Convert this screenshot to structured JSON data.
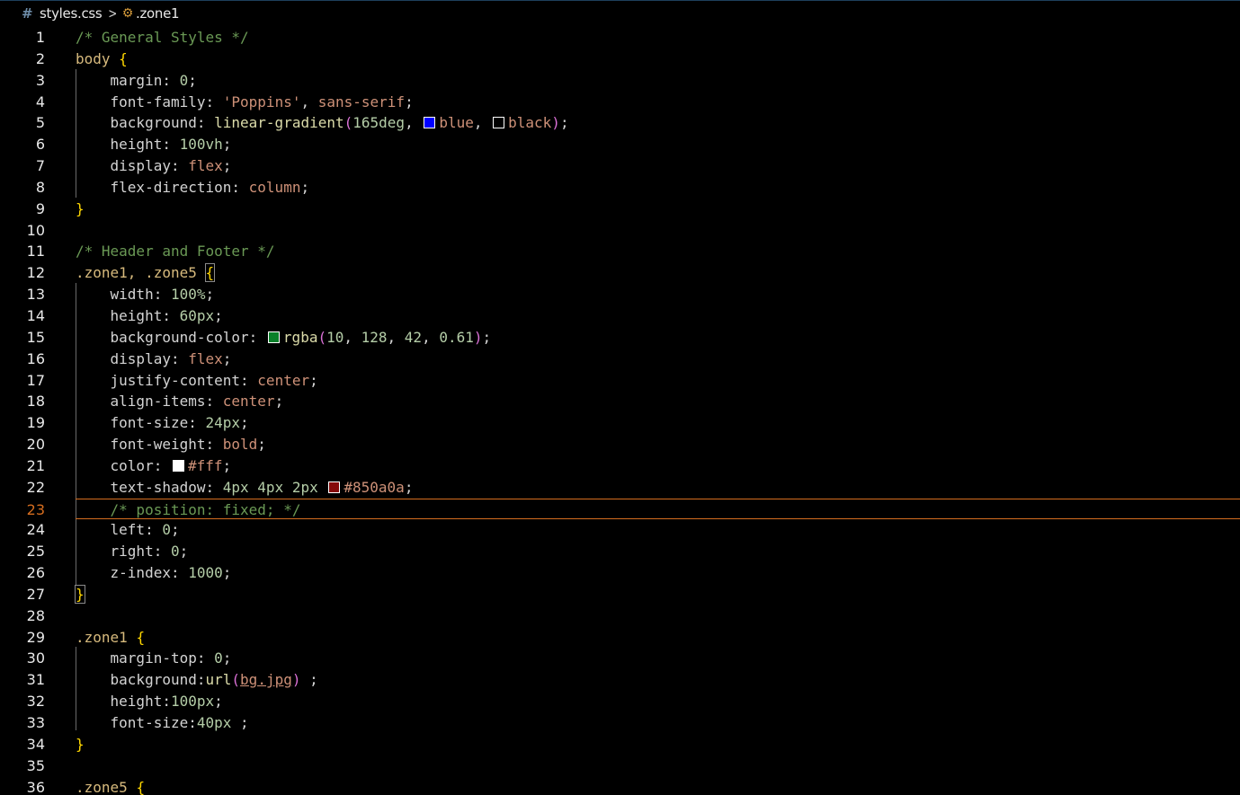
{
  "breadcrumb": {
    "file_icon": "css-hash-icon",
    "file_name": "styles.css",
    "separator": ">",
    "symbol_icon": "css-selector-icon",
    "symbol_name": ".zone1"
  },
  "editor": {
    "current_line": 23,
    "colors": {
      "comment": "#6a9955",
      "selector": "#d7ba7d",
      "value_keyword": "#ce9178",
      "number": "#b5cea8",
      "current_line_border": "#d56d1f"
    },
    "lines": [
      {
        "n": "1",
        "tokens": [
          {
            "t": "/* General Styles */",
            "c": "comment"
          }
        ]
      },
      {
        "n": "2",
        "tokens": [
          {
            "t": "body",
            "c": "sel"
          },
          {
            "t": " "
          },
          {
            "t": "{",
            "c": "brace"
          }
        ]
      },
      {
        "n": "3",
        "tokens": [
          {
            "t": "    margin: "
          },
          {
            "t": "0",
            "c": "num"
          },
          {
            "t": ";"
          }
        ]
      },
      {
        "n": "4",
        "tokens": [
          {
            "t": "    font-family: "
          },
          {
            "t": "'Poppins'",
            "c": "str"
          },
          {
            "t": ", "
          },
          {
            "t": "sans-serif",
            "c": "kw"
          },
          {
            "t": ";"
          }
        ]
      },
      {
        "n": "5",
        "tokens": [
          {
            "t": "    background: "
          },
          {
            "t": "linear-gradient",
            "c": "fn"
          },
          {
            "t": "(",
            "c": "paren"
          },
          {
            "t": "165deg",
            "c": "num"
          },
          {
            "t": ", "
          },
          {
            "swatch": "#0000ff"
          },
          {
            "t": "blue",
            "c": "kw"
          },
          {
            "t": ", "
          },
          {
            "swatch": "#000000"
          },
          {
            "t": "black",
            "c": "kw"
          },
          {
            "t": ")",
            "c": "paren"
          },
          {
            "t": ";"
          }
        ]
      },
      {
        "n": "6",
        "tokens": [
          {
            "t": "    height: "
          },
          {
            "t": "100vh",
            "c": "num"
          },
          {
            "t": ";"
          }
        ]
      },
      {
        "n": "7",
        "tokens": [
          {
            "t": "    display: "
          },
          {
            "t": "flex",
            "c": "kw"
          },
          {
            "t": ";"
          }
        ]
      },
      {
        "n": "8",
        "tokens": [
          {
            "t": "    flex-direction: "
          },
          {
            "t": "column",
            "c": "kw"
          },
          {
            "t": ";"
          }
        ]
      },
      {
        "n": "9",
        "tokens": [
          {
            "t": "}",
            "c": "brace"
          }
        ]
      },
      {
        "n": "10",
        "tokens": []
      },
      {
        "n": "11",
        "tokens": [
          {
            "t": "/* Header and Footer */",
            "c": "comment"
          }
        ]
      },
      {
        "n": "12",
        "tokens": [
          {
            "t": ".zone1, .zone5",
            "c": "sel"
          },
          {
            "t": " "
          },
          {
            "t": "{",
            "c": "brace",
            "box": true
          }
        ]
      },
      {
        "n": "13",
        "tokens": [
          {
            "t": "    width: "
          },
          {
            "t": "100%",
            "c": "num"
          },
          {
            "t": ";"
          }
        ]
      },
      {
        "n": "14",
        "tokens": [
          {
            "t": "    height: "
          },
          {
            "t": "60px",
            "c": "num"
          },
          {
            "t": ";"
          }
        ]
      },
      {
        "n": "15",
        "tokens": [
          {
            "t": "    background-color: "
          },
          {
            "swatch": "#0a802a"
          },
          {
            "t": "rgba",
            "c": "fn"
          },
          {
            "t": "(",
            "c": "paren"
          },
          {
            "t": "10",
            "c": "num"
          },
          {
            "t": ", "
          },
          {
            "t": "128",
            "c": "num"
          },
          {
            "t": ", "
          },
          {
            "t": "42",
            "c": "num"
          },
          {
            "t": ", "
          },
          {
            "t": "0.61",
            "c": "num"
          },
          {
            "t": ")",
            "c": "paren"
          },
          {
            "t": ";"
          }
        ]
      },
      {
        "n": "16",
        "tokens": [
          {
            "t": "    display: "
          },
          {
            "t": "flex",
            "c": "kw"
          },
          {
            "t": ";"
          }
        ]
      },
      {
        "n": "17",
        "tokens": [
          {
            "t": "    justify-content: "
          },
          {
            "t": "center",
            "c": "kw"
          },
          {
            "t": ";"
          }
        ]
      },
      {
        "n": "18",
        "tokens": [
          {
            "t": "    align-items: "
          },
          {
            "t": "center",
            "c": "kw"
          },
          {
            "t": ";"
          }
        ]
      },
      {
        "n": "19",
        "tokens": [
          {
            "t": "    font-size: "
          },
          {
            "t": "24px",
            "c": "num"
          },
          {
            "t": ";"
          }
        ]
      },
      {
        "n": "20",
        "tokens": [
          {
            "t": "    font-weight: "
          },
          {
            "t": "bold",
            "c": "kw"
          },
          {
            "t": ";"
          }
        ]
      },
      {
        "n": "21",
        "tokens": [
          {
            "t": "    color: "
          },
          {
            "swatch": "#ffffff"
          },
          {
            "t": "#fff",
            "c": "kw"
          },
          {
            "t": ";"
          }
        ]
      },
      {
        "n": "22",
        "tokens": [
          {
            "t": "    text-shadow: "
          },
          {
            "t": "4px 4px 2px",
            "c": "num"
          },
          {
            "t": " "
          },
          {
            "swatch": "#850a0a"
          },
          {
            "t": "#850a0a",
            "c": "kw"
          },
          {
            "t": ";"
          }
        ]
      },
      {
        "n": "23",
        "tokens": [
          {
            "t": "    /* position: fixed; */",
            "c": "comment"
          }
        ]
      },
      {
        "n": "24",
        "tokens": [
          {
            "t": "    left: "
          },
          {
            "t": "0",
            "c": "num"
          },
          {
            "t": ";"
          }
        ]
      },
      {
        "n": "25",
        "tokens": [
          {
            "t": "    right: "
          },
          {
            "t": "0",
            "c": "num"
          },
          {
            "t": ";"
          }
        ]
      },
      {
        "n": "26",
        "tokens": [
          {
            "t": "    z-index: "
          },
          {
            "t": "1000",
            "c": "num"
          },
          {
            "t": ";"
          }
        ]
      },
      {
        "n": "27",
        "tokens": [
          {
            "t": "}",
            "c": "brace",
            "box": true
          }
        ]
      },
      {
        "n": "28",
        "tokens": []
      },
      {
        "n": "29",
        "tokens": [
          {
            "t": ".zone1",
            "c": "sel"
          },
          {
            "t": " "
          },
          {
            "t": "{",
            "c": "brace"
          }
        ]
      },
      {
        "n": "30",
        "tokens": [
          {
            "t": "    margin-top: "
          },
          {
            "t": "0",
            "c": "num"
          },
          {
            "t": ";"
          }
        ]
      },
      {
        "n": "31",
        "tokens": [
          {
            "t": "    background:"
          },
          {
            "t": "url",
            "c": "fn"
          },
          {
            "t": "(",
            "c": "paren"
          },
          {
            "t": "bg.jpg",
            "c": "link"
          },
          {
            "t": ")",
            "c": "paren"
          },
          {
            "t": " ;"
          }
        ]
      },
      {
        "n": "32",
        "tokens": [
          {
            "t": "    height:"
          },
          {
            "t": "100px",
            "c": "num"
          },
          {
            "t": ";"
          }
        ]
      },
      {
        "n": "33",
        "tokens": [
          {
            "t": "    font-size:"
          },
          {
            "t": "40px",
            "c": "num"
          },
          {
            "t": " ;"
          }
        ]
      },
      {
        "n": "34",
        "tokens": [
          {
            "t": "}",
            "c": "brace"
          }
        ]
      },
      {
        "n": "35",
        "tokens": []
      },
      {
        "n": "36",
        "tokens": [
          {
            "t": ".zone5",
            "c": "sel"
          },
          {
            "t": " "
          },
          {
            "t": "{",
            "c": "brace"
          }
        ]
      }
    ]
  }
}
